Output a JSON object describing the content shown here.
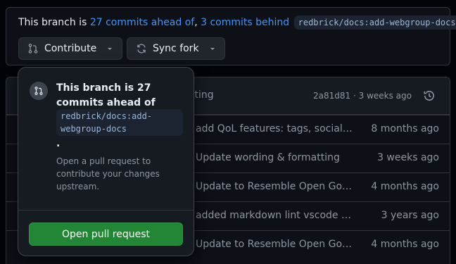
{
  "banner": {
    "prefix": "This branch is",
    "ahead_link": "27 commits ahead of",
    "comma": ",",
    "behind_link": "3 commits behind",
    "branch": "redbrick/docs:add-webgroup-docs",
    "suffix": "."
  },
  "buttons": {
    "contribute": "Contribute",
    "sync_fork": "Sync fork"
  },
  "table_header": {
    "commit_message": "tting",
    "meta": "2a81d81 · 3 weeks ago"
  },
  "rows": [
    {
      "message": "add QoL features: tags, social e...",
      "when": "8 months ago"
    },
    {
      "message": "Update wording & formatting",
      "when": "3 weeks ago"
    },
    {
      "message": "Update to Resemble Open Gove...",
      "when": "4 months ago"
    },
    {
      "message": "added markdown lint vscode ext...",
      "when": "3 years ago"
    },
    {
      "message": "Update to Resemble Open Gove...",
      "when": "4 months ago"
    }
  ],
  "popover": {
    "title": "This branch is 27 commits ahead of",
    "branch": "redbrick/docs:add-webgroup-docs",
    "dot": ".",
    "description": "Open a pull request to contribute your changes upstream.",
    "button": "Open pull request"
  },
  "colors": {
    "link": "#4493f8",
    "primary_button": "#238636",
    "background": "#0d1117"
  }
}
